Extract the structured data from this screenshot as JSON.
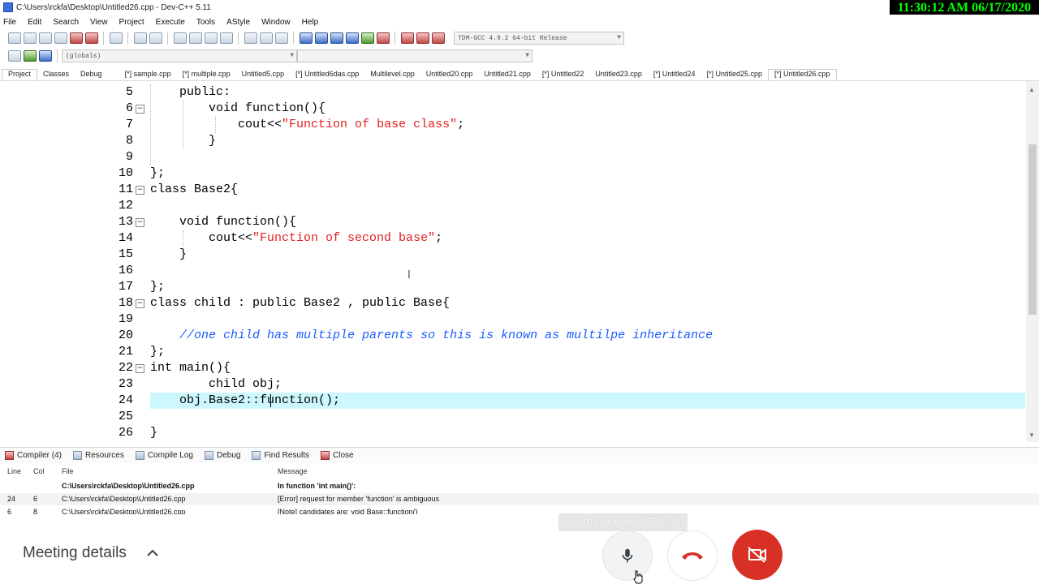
{
  "window": {
    "title": "C:\\Users\\rckfa\\Desktop\\Untitled26.cpp - Dev-C++ 5.11",
    "clock": "11:30:12 AM 06/17/2020"
  },
  "menu": [
    "File",
    "Edit",
    "Search",
    "View",
    "Project",
    "Execute",
    "Tools",
    "AStyle",
    "Window",
    "Help"
  ],
  "toolbar": {
    "compiler_select": "TDM-GCC 4.9.2 64-bit Release",
    "scope_select": "(globals)"
  },
  "project_tabs": [
    "Project",
    "Classes",
    "Debug"
  ],
  "file_tabs": [
    "[*] sample.cpp",
    "[*] multiple.cpp",
    "Untitled5.cpp",
    "[*] Untitled6das.cpp",
    "Multilevel.cpp",
    "Untitled20.cpp",
    "Untitled21.cpp",
    "[*] Untitled22",
    "Untitled23.cpp",
    "[*] Untitled24",
    "[*] Untitled25.cpp",
    "[*] Untitled26.cpp"
  ],
  "active_file_tab": "[*] Untitled26.cpp",
  "editor": {
    "lines": [
      {
        "n": "5",
        "indent": 2,
        "parts": [
          {
            "t": "public:",
            "c": "kw"
          }
        ]
      },
      {
        "n": "6",
        "indent": 4,
        "fold": "⊟",
        "parts": [
          {
            "t": "void function(){",
            "c": "plain"
          }
        ]
      },
      {
        "n": "7",
        "indent": 6,
        "parts": [
          {
            "t": "cout<<",
            "c": "plain"
          },
          {
            "t": "\"Function of base class\"",
            "c": "str"
          },
          {
            "t": ";",
            "c": "plain"
          }
        ]
      },
      {
        "n": "8",
        "indent": 4,
        "parts": [
          {
            "t": "}",
            "c": "plain"
          }
        ]
      },
      {
        "n": "9",
        "indent": 0,
        "parts": []
      },
      {
        "n": "10",
        "indent": 0,
        "parts": [
          {
            "t": "};",
            "c": "plain"
          }
        ]
      },
      {
        "n": "11",
        "indent": 0,
        "fold": "⊟",
        "parts": [
          {
            "t": "class Base2{",
            "c": "plain"
          }
        ]
      },
      {
        "n": "12",
        "indent": 0,
        "parts": []
      },
      {
        "n": "13",
        "indent": 2,
        "fold": "⊟",
        "parts": [
          {
            "t": "void function(){",
            "c": "plain"
          }
        ]
      },
      {
        "n": "14",
        "indent": 4,
        "parts": [
          {
            "t": "cout<<",
            "c": "plain"
          },
          {
            "t": "\"Function of second base\"",
            "c": "str"
          },
          {
            "t": ";",
            "c": "plain"
          }
        ]
      },
      {
        "n": "15",
        "indent": 2,
        "parts": [
          {
            "t": "}",
            "c": "plain"
          }
        ]
      },
      {
        "n": "16",
        "indent": 0,
        "parts": []
      },
      {
        "n": "17",
        "indent": 0,
        "parts": [
          {
            "t": "};",
            "c": "plain"
          }
        ]
      },
      {
        "n": "18",
        "indent": 0,
        "fold": "⊟",
        "parts": [
          {
            "t": "class child : public Base2 , public Base{",
            "c": "plain"
          }
        ]
      },
      {
        "n": "19",
        "indent": 0,
        "parts": []
      },
      {
        "n": "20",
        "indent": 2,
        "parts": [
          {
            "t": "//one child has multiple parents so this is known as multilpe inheritance",
            "c": "cmt"
          }
        ]
      },
      {
        "n": "21",
        "indent": 0,
        "parts": [
          {
            "t": "};",
            "c": "plain"
          }
        ]
      },
      {
        "n": "22",
        "indent": 0,
        "fold": "⊟",
        "parts": [
          {
            "t": "int main(){",
            "c": "plain"
          }
        ]
      },
      {
        "n": "23",
        "indent": 4,
        "parts": [
          {
            "t": "child obj;",
            "c": "plain"
          }
        ]
      },
      {
        "n": "24",
        "indent": 2,
        "highlight": true,
        "parts": [
          {
            "t": "obj.Base2::function();",
            "c": "plain"
          }
        ]
      },
      {
        "n": "25",
        "indent": 0,
        "parts": []
      },
      {
        "n": "26",
        "indent": 0,
        "parts": [
          {
            "t": "}",
            "c": "plain"
          }
        ]
      }
    ]
  },
  "bottom_tabs": [
    "Compiler (4)",
    "Resources",
    "Compile Log",
    "Debug",
    "Find Results",
    "Close"
  ],
  "messages": {
    "headers": {
      "line": "Line",
      "col": "Col",
      "file": "File",
      "message": "Message"
    },
    "rows": [
      {
        "line": "",
        "col": "",
        "file": "C:\\Users\\rckfa\\Desktop\\Untitled26.cpp",
        "message": "In function 'int main()':",
        "bold": true
      },
      {
        "line": "24",
        "col": "6",
        "file": "C:\\Users\\rckfa\\Desktop\\Untitled26.cpp",
        "message": "[Error] request for member 'function' is ambiguous"
      },
      {
        "line": "6",
        "col": "8",
        "file": "C:\\Users\\rckfa\\Desktop\\Untitled26.cpp",
        "message": "[Note] candidates are: void Base::function()"
      }
    ]
  },
  "meet": {
    "details_label": "Meeting details",
    "tooltip": "Turn off microphone (CTRL + D)",
    "mic_icon": "microphone-icon",
    "hangup_icon": "phone-hangup-icon",
    "camera_icon": "camera-off-icon",
    "camera_color": "#d93025",
    "hangup_color": "#d93025"
  }
}
